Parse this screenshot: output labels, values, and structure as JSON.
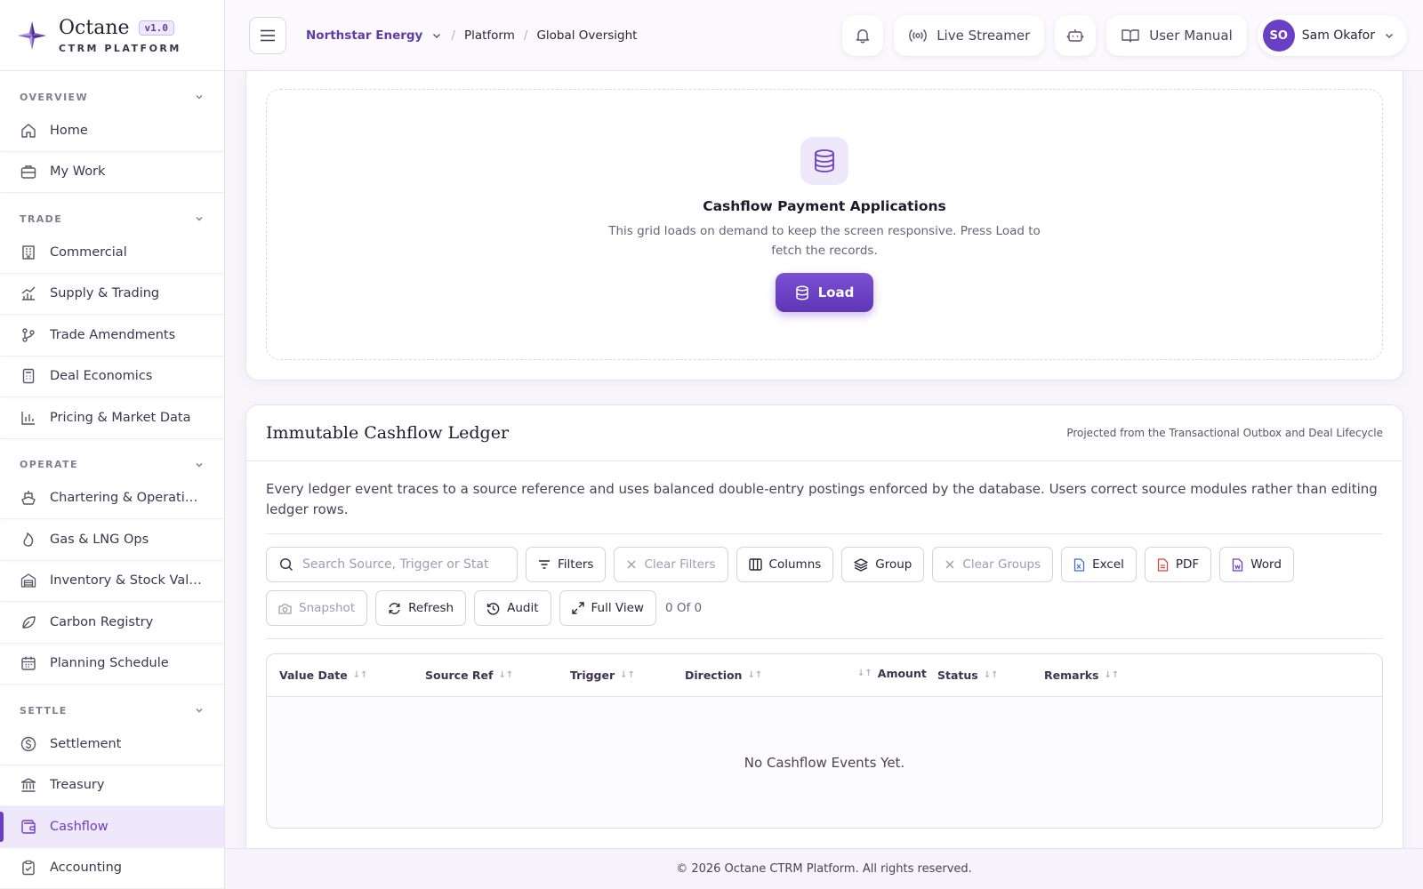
{
  "brand": {
    "name": "Octane",
    "version": "v1.0",
    "subtitle": "CTRM PLATFORM"
  },
  "sidebar": {
    "sections": [
      {
        "label": "OVERVIEW",
        "items": [
          {
            "label": "Home",
            "icon": "home-icon"
          },
          {
            "label": "My Work",
            "icon": "briefcase-icon"
          }
        ]
      },
      {
        "label": "TRADE",
        "items": [
          {
            "label": "Commercial",
            "icon": "building-icon"
          },
          {
            "label": "Supply & Trading",
            "icon": "chart-trend-icon"
          },
          {
            "label": "Trade Amendments",
            "icon": "branch-icon"
          },
          {
            "label": "Deal Economics",
            "icon": "calculator-icon"
          },
          {
            "label": "Pricing & Market Data",
            "icon": "bar-chart-icon"
          }
        ]
      },
      {
        "label": "OPERATE",
        "items": [
          {
            "label": "Chartering & Operations",
            "icon": "ship-icon"
          },
          {
            "label": "Gas & LNG Ops",
            "icon": "flame-icon"
          },
          {
            "label": "Inventory & Stock Valua...",
            "icon": "warehouse-icon"
          },
          {
            "label": "Carbon Registry",
            "icon": "leaf-icon"
          },
          {
            "label": "Planning Schedule",
            "icon": "calendar-icon"
          }
        ]
      },
      {
        "label": "SETTLE",
        "items": [
          {
            "label": "Settlement",
            "icon": "coin-icon"
          },
          {
            "label": "Treasury",
            "icon": "bank-icon"
          },
          {
            "label": "Cashflow",
            "icon": "wallet-icon",
            "active": true
          },
          {
            "label": "Accounting",
            "icon": "clipboard-icon"
          }
        ]
      }
    ]
  },
  "topbar": {
    "organization": "Northstar Energy",
    "breadcrumb": [
      "Platform",
      "Global Oversight"
    ],
    "live_streamer": "Live Streamer",
    "user_manual": "User Manual",
    "user_initials": "SO",
    "user_name": "Sam Okafor"
  },
  "load_panel": {
    "title": "Cashflow Payment Applications",
    "description": "This grid loads on demand to keep the screen responsive. Press Load to fetch the records.",
    "button": "Load"
  },
  "ledger": {
    "title": "Immutable Cashflow Ledger",
    "subtitle": "Projected from the Transactional Outbox and Deal Lifecycle",
    "description": "Every ledger event traces to a source reference and uses balanced double-entry postings enforced by the database. Users correct source modules rather than editing ledger rows.",
    "search_placeholder": "Search Source, Trigger or Status",
    "toolbar": {
      "filters": "Filters",
      "clear_filters": "Clear Filters",
      "columns": "Columns",
      "group": "Group",
      "clear_groups": "Clear Groups",
      "excel": "Excel",
      "pdf": "PDF",
      "word": "Word",
      "snapshot": "Snapshot",
      "refresh": "Refresh",
      "audit": "Audit",
      "full_view": "Full View"
    },
    "record_count": "0 Of 0",
    "columns": [
      "Value Date",
      "Source Ref",
      "Trigger",
      "Direction",
      "Amount",
      "Status",
      "Remarks"
    ],
    "empty_message": "No Cashflow Events Yet."
  },
  "footer": {
    "text": "© 2026 Octane CTRM Platform. All rights reserved."
  },
  "colors": {
    "accent": "#6a3fc4",
    "accent_light": "#efe8fb"
  }
}
